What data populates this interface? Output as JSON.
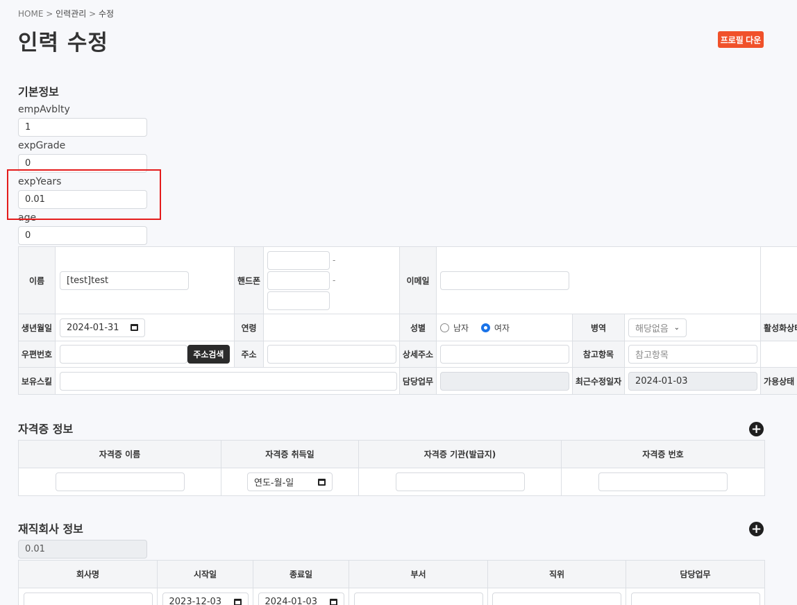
{
  "breadcrumb": {
    "home": "HOME",
    "sep1": ">",
    "level1": "인력관리",
    "sep2": ">",
    "current": "수정"
  },
  "page_title": "인력 수정",
  "profile_button": "프로필 다운",
  "basic_section": {
    "heading": "기본정보",
    "fields": [
      {
        "label": "empAvblty",
        "value": "1"
      },
      {
        "label": "expGrade",
        "value": "0"
      },
      {
        "label": "expYears",
        "value": "0.01"
      },
      {
        "label": "age",
        "value": "0"
      }
    ]
  },
  "info_table": {
    "name_label": "이름",
    "name_value": "[test]test",
    "phone_label": "핸드폰",
    "phone_sep": "-",
    "email_label": "이메일",
    "birth_label": "생년월일",
    "birth_value": "2024-01-31",
    "age_label": "연령",
    "gender_label": "성별",
    "gender_male": "남자",
    "gender_female": "여자",
    "gender_selected": "여자",
    "military_label": "병역",
    "military_value": "해당없음",
    "active_label": "활성화상태",
    "zip_label": "우편번호",
    "addr_search_button": "주소검색",
    "addr_label": "주소",
    "addr_detail_label": "상세주소",
    "ref_label": "참고항목",
    "ref_placeholder": "참고항목",
    "skill_label": "보유스킬",
    "duty_label": "담당업무",
    "modified_label": "최근수정일자",
    "modified_value": "2024-01-03",
    "avail_label": "가용상태"
  },
  "cert_section": {
    "heading": "자격증 정보",
    "columns": [
      "자격증 이름",
      "자격증 취득일",
      "자격증 기관(발급지)",
      "자격증 번호"
    ],
    "date_placeholder": "연도-월-일"
  },
  "company_section": {
    "heading": "재직회사 정보",
    "summary_value": "0.01",
    "columns": [
      "회사명",
      "시작일",
      "종료일",
      "부서",
      "직위",
      "담당업무"
    ],
    "start_value": "2023-12-03",
    "end_value": "2024-01-03"
  }
}
